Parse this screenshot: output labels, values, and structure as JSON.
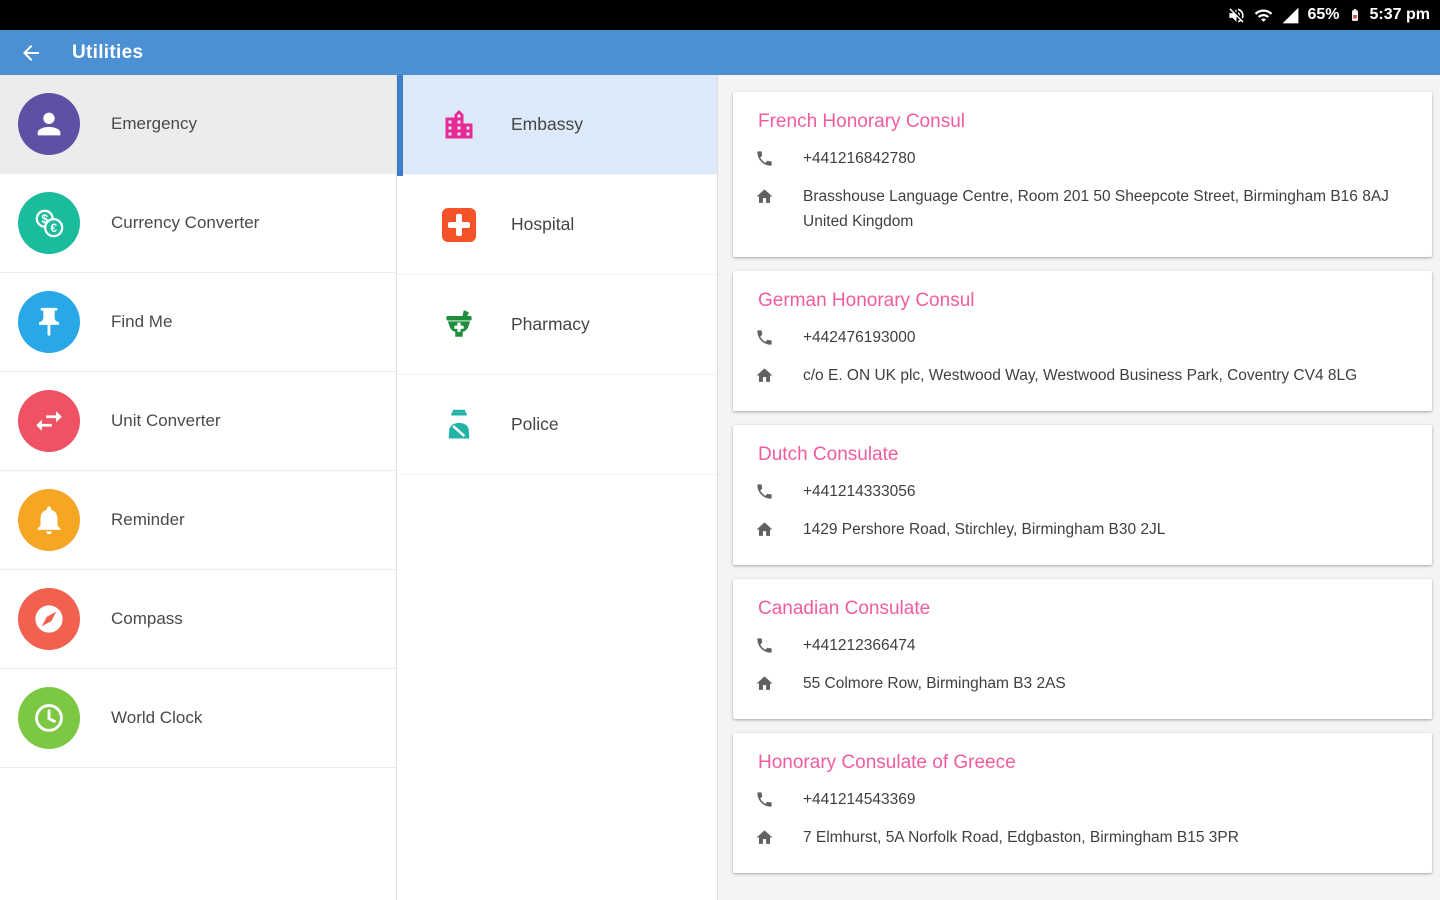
{
  "status_bar": {
    "battery_percent": "65%",
    "time": "5:37 pm",
    "icons": [
      "volume-muted-icon",
      "wifi-icon",
      "signal-icon",
      "battery-icon"
    ]
  },
  "app_bar": {
    "title": "Utilities",
    "back_icon": "arrow-left-icon"
  },
  "sidebar": {
    "items": [
      {
        "label": "Emergency",
        "icon": "person-icon",
        "color": "#5d51a5",
        "selected": true
      },
      {
        "label": "Currency Converter",
        "icon": "coins-icon",
        "color": "#1abc9c",
        "selected": false
      },
      {
        "label": "Find Me",
        "icon": "pushpin-icon",
        "color": "#29a8e8",
        "selected": false
      },
      {
        "label": "Unit Converter",
        "icon": "swap-arrows-icon",
        "color": "#ef5264",
        "selected": false
      },
      {
        "label": "Reminder",
        "icon": "bell-icon",
        "color": "#f5a623",
        "selected": false
      },
      {
        "label": "Compass",
        "icon": "compass-icon",
        "color": "#f2604f",
        "selected": false
      },
      {
        "label": "World Clock",
        "icon": "clock-icon",
        "color": "#7cc843",
        "selected": false
      }
    ]
  },
  "categories": {
    "items": [
      {
        "label": "Embassy",
        "icon": "building-icon",
        "color": "#e62a94",
        "selected": true
      },
      {
        "label": "Hospital",
        "icon": "medical-cross-icon",
        "color": "#f4532a",
        "selected": false
      },
      {
        "label": "Pharmacy",
        "icon": "mortar-icon",
        "color": "#1e8e3e",
        "selected": false
      },
      {
        "label": "Police",
        "icon": "police-officer-icon",
        "color": "#22b2a8",
        "selected": false
      }
    ]
  },
  "results": {
    "cards": [
      {
        "title": "French Honorary Consul",
        "phone": "+441216842780",
        "address": "Brasshouse Language Centre, Room 201 50 Sheepcote Street, Birmingham B16 8AJ United Kingdom"
      },
      {
        "title": "German Honorary Consul",
        "phone": "+442476193000",
        "address": "c/o E. ON UK plc, Westwood Way, Westwood Business Park, Coventry CV4 8LG"
      },
      {
        "title": "Dutch Consulate",
        "phone": "+441214333056",
        "address": "1429 Pershore Road, Stirchley, Birmingham B30 2JL"
      },
      {
        "title": "Canadian Consulate",
        "phone": "+441212366474",
        "address": "55 Colmore Row, Birmingham B3 2AS"
      },
      {
        "title": "Honorary Consulate of Greece",
        "phone": "+441214543369",
        "address": "7 Elmhurst, 5A Norfolk Road, Edgbaston, Birmingham B15 3PR"
      }
    ]
  },
  "colors": {
    "app_bar_blue": "#4a90d2",
    "selection_indicator_blue": "#3e7dc8",
    "selected_category_bg": "#dce9f8",
    "selected_sidebar_bg": "#ececec",
    "card_title_pink": "#f25c9f"
  }
}
